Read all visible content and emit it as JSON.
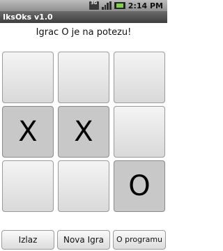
{
  "status_bar": {
    "network": "3G",
    "signal_icon": "signal-bars-icon",
    "battery_icon": "battery-icon",
    "time": "2:14 PM"
  },
  "app": {
    "title": "IksOks v1.0"
  },
  "game": {
    "message": "Igrac O je na potezu!",
    "board": [
      [
        "",
        "",
        ""
      ],
      [
        "X",
        "X",
        ""
      ],
      [
        "",
        "",
        "O"
      ]
    ]
  },
  "buttons": {
    "exit": "Izlaz",
    "new_game": "Nova Igra",
    "about": "O programu"
  }
}
